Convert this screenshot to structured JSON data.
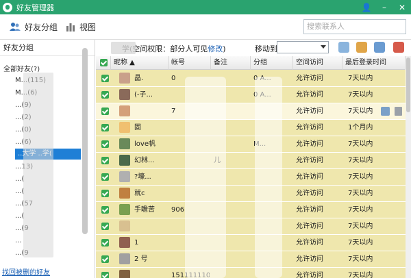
{
  "window": {
    "title": "好友管理器",
    "buttons": [
      "👤",
      "–",
      "✕"
    ]
  },
  "toolbar": {
    "friends_group": "好友分组",
    "view": "视图",
    "search_placeholder": "搜索联系人"
  },
  "left": {
    "header": "好友分组",
    "items": [
      {
        "label": "全部好友(?)",
        "child": false
      },
      {
        "label": "M...(115)",
        "child": true
      },
      {
        "label": "M...(6)",
        "child": true
      },
      {
        "label": "...(9)",
        "child": true
      },
      {
        "label": "...(2)",
        "child": true
      },
      {
        "label": "...(0)",
        "child": true
      },
      {
        "label": "...(6)",
        "child": true
      },
      {
        "label": "..大学 ..学(",
        "child": true,
        "selected": true
      },
      {
        "label": "...13)",
        "child": true
      },
      {
        "label": "...(",
        "child": true
      },
      {
        "label": "...(",
        "child": true
      },
      {
        "label": "...(57",
        "child": true
      },
      {
        "label": "...(",
        "child": true
      },
      {
        "label": "...(9",
        "child": true
      },
      {
        "label": "...",
        "child": true
      },
      {
        "label": "...(9",
        "child": true
      },
      {
        "label": "...",
        "child": true
      }
    ],
    "recover_link": "找回被删的好友"
  },
  "info": {
    "group_suffix": "学(空间权限：部分人可见",
    "edit_link": "修改",
    "close_paren": ")",
    "move_to": "移动到"
  },
  "table": {
    "headers": [
      "昵称 ▲",
      "帐号",
      "备注",
      "分组",
      "空间访问",
      "最后登录时间"
    ],
    "rows": [
      {
        "nick": "晶.",
        "account": "0",
        "note": "",
        "group": "0 A...",
        "access": "允许访问",
        "last": "7天以内",
        "hl": false
      },
      {
        "nick": "(-子...",
        "account": "",
        "note": "",
        "group": "0 A...",
        "access": "允许访问",
        "last": "7天以内",
        "hl": false
      },
      {
        "nick": "",
        "account": "7",
        "note": "",
        "group": "",
        "access": "允许访问",
        "last": "7天以内",
        "hl": true
      },
      {
        "nick": "固",
        "account": "",
        "note": "",
        "group": "",
        "access": "允许访问",
        "last": "1个月内",
        "hl": false
      },
      {
        "nick": "love帆",
        "account": "",
        "note": "",
        "group": "M...",
        "access": "允许访问",
        "last": "7天以内",
        "hl": false
      },
      {
        "nick": "幻林...",
        "account": "",
        "note": "儿",
        "group": "",
        "access": "允许访问",
        "last": "7天以内",
        "hl": false
      },
      {
        "nick": "?壕...",
        "account": "",
        "note": "",
        "group": "",
        "access": "允许访问",
        "last": "7天以内",
        "hl": false
      },
      {
        "nick": "就c",
        "account": "",
        "note": "",
        "group": "",
        "access": "允许访问",
        "last": "7天以内",
        "hl": false
      },
      {
        "nick": "手瞻苦",
        "account": "906",
        "note": "",
        "group": "",
        "access": "允许访问",
        "last": "7天以内",
        "hl": false
      },
      {
        "nick": "",
        "account": "",
        "note": "",
        "group": "",
        "access": "允许访问",
        "last": "7天以内",
        "hl": false
      },
      {
        "nick": "1",
        "account": "",
        "note": "",
        "group": "",
        "access": "允许访问",
        "last": "7天以内",
        "hl": false
      },
      {
        "nick": "2 号",
        "account": "",
        "note": "",
        "group": "",
        "access": "允许访问",
        "last": "7天以内",
        "hl": false
      },
      {
        "nick": "",
        "account": "151111110",
        "note": "",
        "group": "",
        "access": "允许访问",
        "last": "7天以内",
        "hl": false
      }
    ]
  },
  "colors": {
    "title_bar": "#2aa36f",
    "row_bg": "#efe7ad",
    "row_highlight": "#fbf6dc",
    "checkbox": "#36a852",
    "selection": "#1f7fd6"
  }
}
